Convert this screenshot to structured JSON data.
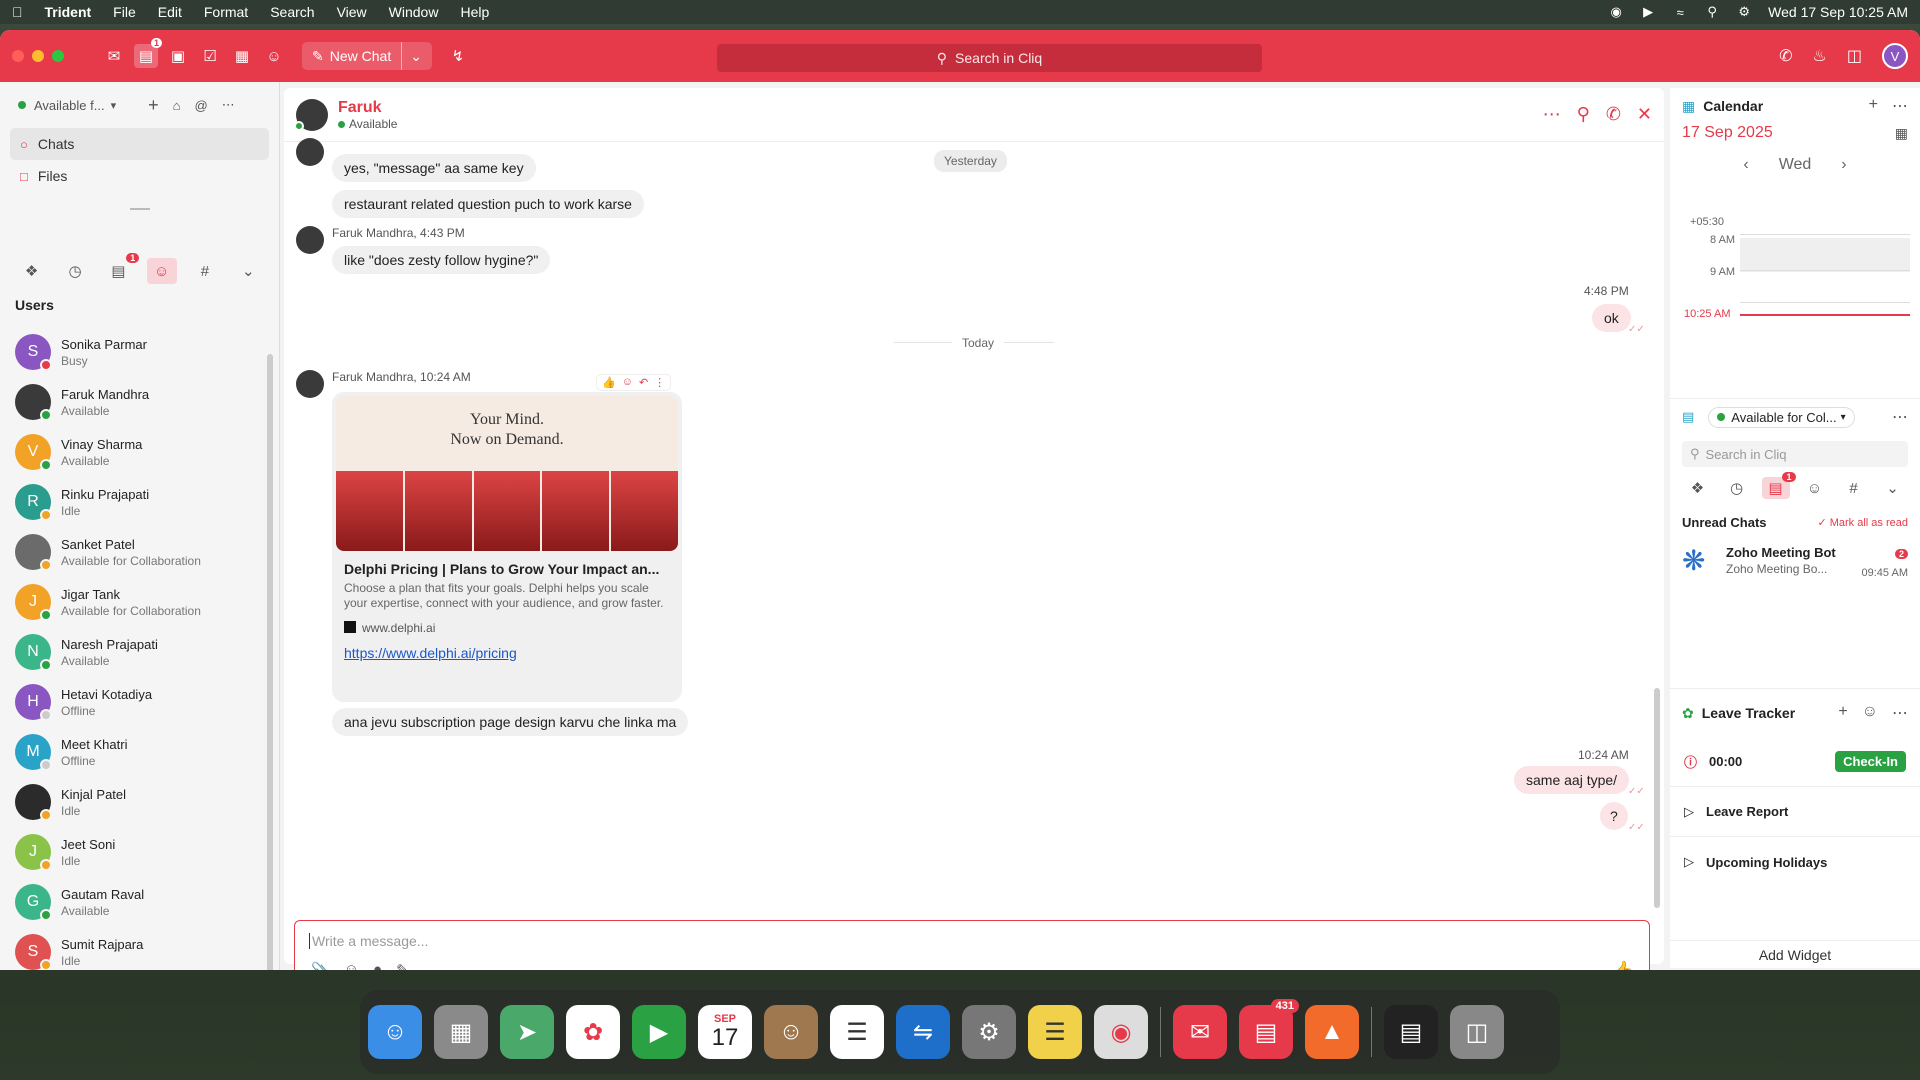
{
  "menubar": {
    "app": "Trident",
    "items": [
      "File",
      "Edit",
      "Format",
      "Search",
      "View",
      "Window",
      "Help"
    ],
    "datetime": "Wed 17 Sep  10:25 AM"
  },
  "titlebar": {
    "chat_badge": "1",
    "new_chat_label": "New Chat",
    "search_placeholder": "Search in Cliq",
    "avatar_letter": "V"
  },
  "left": {
    "status": "Available f...",
    "nav": [
      {
        "label": "Chats"
      },
      {
        "label": "Files"
      }
    ],
    "tab_badge": "1",
    "users_heading": "Users",
    "users": [
      {
        "initial": "S",
        "name": "Sonika Parmar",
        "status": "Busy",
        "color": "#8a56c2",
        "sd": "#e6394a"
      },
      {
        "initial": "",
        "name": "Faruk Mandhra",
        "status": "Available",
        "color": "#3a3a3a",
        "sd": "#2aa143"
      },
      {
        "initial": "V",
        "name": "Vinay Sharma",
        "status": "Available",
        "color": "#f2a227",
        "sd": "#2aa143"
      },
      {
        "initial": "R",
        "name": "Rinku Prajapati",
        "status": "Idle",
        "color": "#2a9d8f",
        "sd": "#f2a227"
      },
      {
        "initial": "",
        "name": "Sanket Patel",
        "status": "Available for Collaboration",
        "color": "#6b6b6b",
        "sd": "#f2a227"
      },
      {
        "initial": "J",
        "name": "Jigar Tank",
        "status": "Available for Collaboration",
        "color": "#f2a227",
        "sd": "#2aa143"
      },
      {
        "initial": "N",
        "name": "Naresh Prajapati",
        "status": "Available",
        "color": "#3bb58a",
        "sd": "#2aa143"
      },
      {
        "initial": "H",
        "name": "Hetavi Kotadiya",
        "status": "Offline",
        "color": "#8a56c2",
        "sd": "#cccccc"
      },
      {
        "initial": "M",
        "name": "Meet Khatri",
        "status": "Offline",
        "color": "#2aa3c9",
        "sd": "#cccccc"
      },
      {
        "initial": "",
        "name": "Kinjal Patel",
        "status": "Idle",
        "color": "#2b2b2b",
        "sd": "#f2a227"
      },
      {
        "initial": "J",
        "name": "Jeet Soni",
        "status": "Idle",
        "color": "#8bc34a",
        "sd": "#f2a227"
      },
      {
        "initial": "G",
        "name": "Gautam Raval",
        "status": "Available",
        "color": "#3bb58a",
        "sd": "#2aa143"
      },
      {
        "initial": "S",
        "name": "Sumit Rajpara",
        "status": "Idle",
        "color": "#e05252",
        "sd": "#f2a227"
      }
    ]
  },
  "chat": {
    "contact_name": "Faruk",
    "contact_status": "Available",
    "day_yesterday": "Yesterday",
    "day_today": "Today",
    "msg1": "yes, \"message\" aa same key",
    "msg2": "restaurant related question puch to work karse",
    "sender2": "Faruk Mandhra,",
    "time2": "4:43 PM",
    "msg3": "like \"does zesty follow hygine?\"",
    "time_me1": "4:48 PM",
    "msg_me1": "ok",
    "sender3": "Faruk Mandhra,",
    "time3": "10:24 AM",
    "card_headline": "Your Mind.\nNow on Demand.",
    "card_title": "Delphi Pricing | Plans to Grow Your Impact an...",
    "card_desc": "Choose a plan that fits your goals. Delphi helps you scale your expertise, connect with your audience, and grow faster.",
    "card_domain": "www.delphi.ai",
    "card_link": "https://www.delphi.ai/pricing",
    "msg4": "ana jevu subscription page design karvu che linka ma",
    "time_me2": "10:24 AM",
    "msg_me2": "same aaj type/",
    "msg_me3": "?",
    "composer_placeholder": "Write a message..."
  },
  "right": {
    "calendar_title": "Calendar",
    "calendar_date": "17 Sep 2025",
    "calendar_day": "Wed",
    "tz": "+05:30",
    "hours": [
      "8 AM",
      "9 AM",
      "10:25 AM"
    ],
    "chat_status": "Available for Col...",
    "search_placeholder": "Search in Cliq",
    "tab_badge": "1",
    "unread_heading": "Unread Chats",
    "mark_all": "Mark all as read",
    "unread_name": "Zoho Meeting Bot",
    "unread_preview": "Zoho Meeting Bo...",
    "unread_time": "09:45 AM",
    "unread_count": "2",
    "leave_title": "Leave Tracker",
    "timer": "00:00",
    "checkin": "Check-In",
    "leave_report": "Leave Report",
    "holidays": "Upcoming Holidays",
    "add_widget": "Add Widget"
  },
  "dock": {
    "calendar_month": "SEP",
    "calendar_day": "17",
    "badge": "431"
  }
}
